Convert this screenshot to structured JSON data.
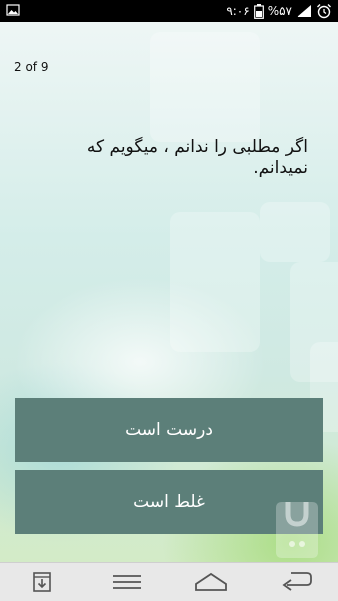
{
  "status_bar": {
    "time": "۹:۰۶",
    "battery": "%۵۷",
    "icons": [
      "gallery-icon",
      "alarm-icon",
      "signal-icon",
      "battery-icon"
    ]
  },
  "quiz": {
    "counter": "2 of 9",
    "question": "اگر مطلبی را ندانم ، میگویم که نمیدانم.",
    "answers": {
      "true_label": "درست است",
      "false_label": "غلط است"
    }
  },
  "nav_bar": {
    "icons": [
      "download-icon",
      "menu-icon",
      "home-icon",
      "back-icon"
    ]
  },
  "colors": {
    "button": "#5c7f79",
    "status_bar": "#000000",
    "nav_bar": "#e8e8e8"
  }
}
